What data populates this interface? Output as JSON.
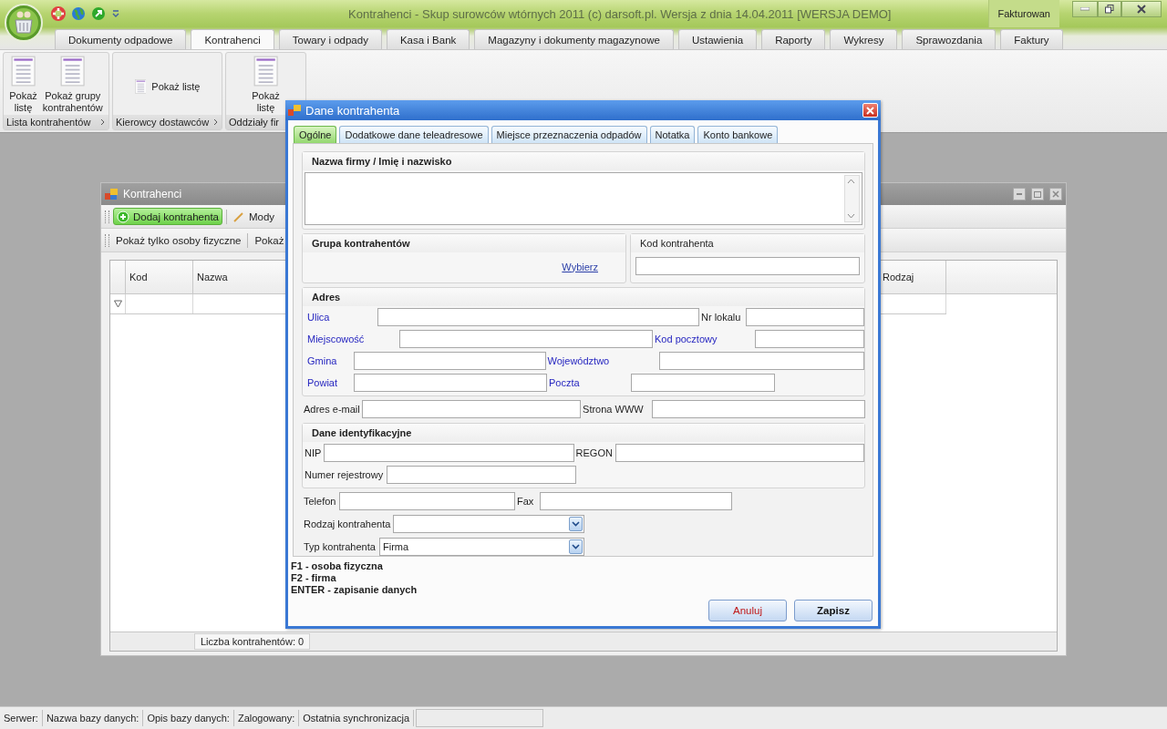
{
  "window": {
    "title": "Kontrahenci - Skup surowców wtórnych 2011 (c) darsoft.pl. Wersja z dnia 14.04.2011 [WERSJA DEMO]",
    "side_label": "Fakturowan"
  },
  "ribbon_tabs": [
    {
      "label": "Dokumenty odpadowe",
      "selected": false
    },
    {
      "label": "Kontrahenci",
      "selected": true
    },
    {
      "label": "Towary i odpady",
      "selected": false
    },
    {
      "label": "Kasa i Bank",
      "selected": false
    },
    {
      "label": "Magazyny i dokumenty magazynowe",
      "selected": false
    },
    {
      "label": "Ustawienia",
      "selected": false
    },
    {
      "label": "Raporty",
      "selected": false
    },
    {
      "label": "Wykresy",
      "selected": false
    },
    {
      "label": "Sprawozdania",
      "selected": false
    },
    {
      "label": "Faktury",
      "selected": false
    }
  ],
  "ribbon_groups": [
    {
      "label": "Lista kontrahentów",
      "launcher": true,
      "buttons": [
        {
          "label": "Pokaż\nlistę",
          "kind": "large"
        },
        {
          "label": "Pokaż grupy\nkontrahentów",
          "kind": "large"
        }
      ]
    },
    {
      "label": "Kierowcy dostawców",
      "launcher": true,
      "buttons": [
        {
          "label": "Pokaż listę",
          "kind": "small"
        }
      ]
    },
    {
      "label": "Oddziały fir",
      "launcher": false,
      "buttons": [
        {
          "label": "Pokaż\nlistę",
          "kind": "large"
        }
      ]
    }
  ],
  "child_window": {
    "title": "Kontrahenci",
    "toolbar": [
      {
        "label": "Dodaj kontrahenta",
        "kind": "add"
      },
      {
        "label": "Mody",
        "kind": "edit"
      }
    ],
    "filter_bar": [
      "Pokaż tylko osoby fizyczne",
      "Pokaż"
    ],
    "columns": [
      "Kod",
      "Nazwa",
      "Rodzaj"
    ],
    "footer": "Liczba kontrahentów: 0"
  },
  "dialog": {
    "title": "Dane kontrahenta",
    "tabs": [
      {
        "label": "Ogólne",
        "selected": true
      },
      {
        "label": "Dodatkowe dane teleadresowe",
        "selected": false
      },
      {
        "label": "Miejsce przeznaczenia odpadów",
        "selected": false
      },
      {
        "label": "Notatka",
        "selected": false
      },
      {
        "label": "Konto bankowe",
        "selected": false
      }
    ],
    "name_group": {
      "title": "Nazwa firmy / Imię i nazwisko"
    },
    "group_panel": {
      "title": "Grupa kontrahentów",
      "link": "Wybierz"
    },
    "code_panel": {
      "label": "Kod kontrahenta"
    },
    "address": {
      "title": "Adres",
      "rows": [
        [
          {
            "label": "Ulica",
            "linked": true
          },
          {
            "label": "Nr lokalu",
            "linked": false
          }
        ],
        [
          {
            "label": "Miejscowość",
            "linked": true
          },
          {
            "label": "Kod pocztowy",
            "linked": true
          }
        ],
        [
          {
            "label": "Gmina",
            "linked": true
          },
          {
            "label": "Województwo",
            "linked": true
          }
        ],
        [
          {
            "label": "Powiat",
            "linked": true
          },
          {
            "label": "Poczta",
            "linked": true
          }
        ]
      ]
    },
    "contact": [
      [
        {
          "label": "Adres e-mail"
        },
        {
          "label": "Strona WWW"
        }
      ]
    ],
    "identification": {
      "title": "Dane identyfikacyjne",
      "rows": [
        [
          {
            "label": "NIP"
          },
          {
            "label": "REGON"
          }
        ],
        [
          {
            "label": "Numer rejestrowy"
          }
        ]
      ]
    },
    "details": [
      [
        {
          "label": "Telefon",
          "kind": "text"
        },
        {
          "label": "Fax",
          "kind": "text"
        }
      ],
      [
        {
          "label": "Rodzaj kontrahenta",
          "kind": "select"
        }
      ],
      [
        {
          "label": "Typ kontrahenta",
          "kind": "select",
          "value": "Firma"
        }
      ]
    ],
    "help": [
      "F1 - osoba fizyczna",
      "F2 - firma",
      "ENTER - zapisanie danych"
    ],
    "buttons": [
      {
        "label": "Anuluj",
        "kind": "cancel"
      },
      {
        "label": "Zapisz",
        "kind": "confirm"
      }
    ]
  },
  "status_bar": [
    "Serwer:",
    "Nazwa bazy danych:",
    "Opis bazy danych:",
    "Zalogowany:",
    "Ostatnia synchronizacja"
  ]
}
